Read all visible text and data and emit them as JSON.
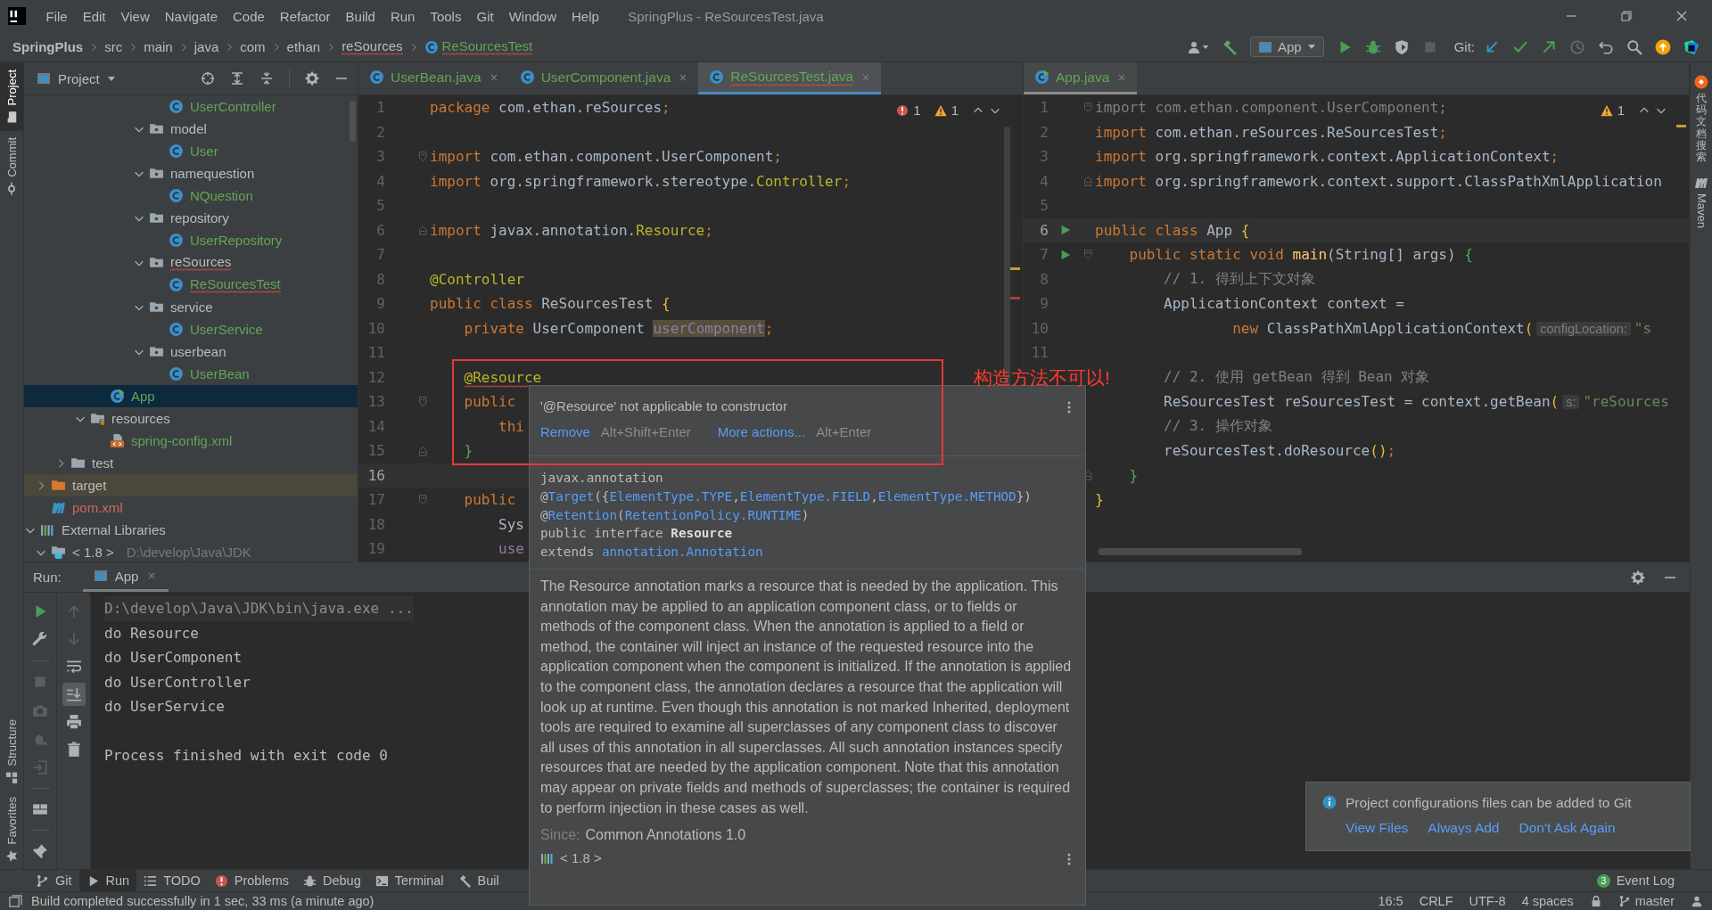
{
  "title_bar": {
    "menus": [
      "File",
      "Edit",
      "View",
      "Navigate",
      "Code",
      "Refactor",
      "Build",
      "Run",
      "Tools",
      "Git",
      "Window",
      "Help"
    ],
    "title": "SpringPlus - ReSourcesTest.java"
  },
  "nav_bar": {
    "breadcrumbs": [
      {
        "label": "SpringPlus",
        "kind": "project",
        "error": false
      },
      {
        "label": "src",
        "kind": "folder",
        "error": false
      },
      {
        "label": "main",
        "kind": "folder",
        "error": false
      },
      {
        "label": "java",
        "kind": "folder",
        "error": false
      },
      {
        "label": "com",
        "kind": "folder",
        "error": false
      },
      {
        "label": "ethan",
        "kind": "folder",
        "error": false
      },
      {
        "label": "reSources",
        "kind": "folder",
        "error": true
      },
      {
        "label": "ReSourcesTest",
        "kind": "class",
        "error": true
      }
    ],
    "run_config": "App",
    "git_label": "Git:"
  },
  "left_stripe": {
    "top": [
      {
        "label": "Project",
        "selected": true
      },
      {
        "label": "Commit",
        "selected": false
      }
    ],
    "bottom": [
      {
        "label": "Structure",
        "selected": false
      },
      {
        "label": "Favorites",
        "selected": false
      }
    ]
  },
  "right_stripe": [
    {
      "label": "代码文档搜索",
      "kind": "cjk"
    },
    {
      "label": "Maven",
      "kind": "latin"
    }
  ],
  "project_panel": {
    "title": "Project",
    "tree": [
      {
        "children": [
          {
            "children": [
              {
                "children": [
                  {
                    "children": [
                      {
                        "children": [
                          {
                            "children": [
                              {
                                "children": [
                                  {
                                    "label": "UserController",
                                    "kind": "class",
                                    "color": "#62a557",
                                    "selected": false,
                                    "error": false
                                  }
                                ]
                              },
                              {
                                "label": "model",
                                "kind": "package",
                                "expanded": true,
                                "selected": false,
                                "error": false,
                                "children": [
                                  {
                                    "label": "User",
                                    "kind": "class",
                                    "color": "#62a557",
                                    "selected": false,
                                    "error": false
                                  }
                                ]
                              },
                              {
                                "label": "namequestion",
                                "kind": "package",
                                "expanded": true,
                                "selected": false,
                                "error": false,
                                "children": [
                                  {
                                    "label": "NQuestion",
                                    "kind": "class",
                                    "color": "#62a557",
                                    "selected": false,
                                    "error": false
                                  }
                                ]
                              },
                              {
                                "label": "repository",
                                "kind": "package",
                                "expanded": true,
                                "selected": false,
                                "error": false,
                                "children": [
                                  {
                                    "label": "UserRepository",
                                    "kind": "class",
                                    "color": "#62a557",
                                    "selected": false,
                                    "error": false
                                  }
                                ]
                              },
                              {
                                "label": "reSources",
                                "kind": "package",
                                "expanded": true,
                                "selected": false,
                                "error": true,
                                "children": [
                                  {
                                    "label": "ReSourcesTest",
                                    "kind": "class",
                                    "color": "#62a557",
                                    "selected": false,
                                    "error": true
                                  }
                                ]
                              },
                              {
                                "label": "service",
                                "kind": "package",
                                "expanded": true,
                                "selected": false,
                                "error": false,
                                "children": [
                                  {
                                    "label": "UserService",
                                    "kind": "class",
                                    "color": "#62a557",
                                    "selected": false,
                                    "error": false
                                  }
                                ]
                              },
                              {
                                "label": "userbean",
                                "kind": "package",
                                "expanded": true,
                                "selected": false,
                                "error": false,
                                "children": [
                                  {
                                    "label": "UserBean",
                                    "kind": "class",
                                    "color": "#62a557",
                                    "selected": false,
                                    "error": false
                                  }
                                ]
                              }
                            ]
                          }
                        ]
                      },
                      {
                        "label": "App",
                        "kind": "main",
                        "color": "#62a557",
                        "selected": true,
                        "error": false
                      }
                    ]
                  },
                  {
                    "label": "resources",
                    "kind": "resources",
                    "expanded": true,
                    "selected": false,
                    "error": false,
                    "children": [
                      {
                        "label": "spring-config.xml",
                        "kind": "xml",
                        "color": "#62a557",
                        "selected": false,
                        "error": false
                      }
                    ]
                  }
                ]
              },
              {
                "label": "test",
                "kind": "folder",
                "expanded": false,
                "selected": false,
                "error": false
              }
            ]
          },
          {
            "label": "target",
            "kind": "excluded",
            "expanded": false,
            "selected": false,
            "error": false
          },
          {
            "label": "pom.xml",
            "kind": "maven",
            "color": "#d1675a",
            "selected": false,
            "error": false
          }
        ]
      },
      {
        "label": "External Libraries",
        "kind": "libraries",
        "expanded": true,
        "selected": false,
        "error": false,
        "children": [
          {
            "label": "< 1.8 >",
            "detail": "D:\\develop\\Java\\JDK",
            "kind": "jdk",
            "expanded": true,
            "selected": false,
            "error": false
          }
        ]
      }
    ]
  },
  "left_editor": {
    "focused": true,
    "tabs": [
      {
        "label": "UserBean.java",
        "color": "#62a557",
        "selected": false,
        "error": false
      },
      {
        "label": "UserComponent.java",
        "color": "#62a557",
        "selected": false,
        "error": false
      },
      {
        "label": "ReSourcesTest.java",
        "color": "#62a557",
        "selected": true,
        "error": true
      }
    ],
    "errors": "1",
    "warnings": "1",
    "stripe_marks": [
      {
        "kind": "warning"
      },
      {
        "kind": "error"
      }
    ],
    "lines": [
      {
        "n": "1",
        "current": false,
        "tokens": [
          {
            "kind": "kw",
            "text": "package"
          },
          {
            "kind": "p",
            "text": " com.ethan.reSources"
          },
          {
            "kind": "kw",
            "text": ";"
          }
        ]
      },
      {
        "n": "2",
        "current": false
      },
      {
        "n": "3",
        "current": false,
        "fold_start": true,
        "tokens": [
          {
            "kind": "kw",
            "text": "import"
          },
          {
            "kind": "p",
            "text": " com.ethan.component.UserComponent"
          },
          {
            "kind": "kw",
            "text": ";"
          }
        ]
      },
      {
        "n": "4",
        "current": false,
        "tokens": [
          {
            "kind": "kw",
            "text": "import"
          },
          {
            "kind": "p",
            "text": " org.springframework.stereotype."
          },
          {
            "kind": "ann",
            "text": "Controller"
          },
          {
            "kind": "kw",
            "text": ";"
          }
        ]
      },
      {
        "n": "5",
        "current": false
      },
      {
        "n": "6",
        "current": false,
        "fold_end": true,
        "tokens": [
          {
            "kind": "kw",
            "text": "import"
          },
          {
            "kind": "p",
            "text": " javax.annotation."
          },
          {
            "kind": "ann",
            "text": "Resource"
          },
          {
            "kind": "kw",
            "text": ";"
          }
        ]
      },
      {
        "n": "7",
        "current": false
      },
      {
        "n": "8",
        "current": false,
        "tokens": [
          {
            "kind": "ann",
            "text": "@Controller"
          }
        ]
      },
      {
        "n": "9",
        "current": false,
        "tokens": [
          {
            "kind": "kw",
            "text": "public class"
          },
          {
            "kind": "p",
            "text": " ReSourcesTest "
          },
          {
            "kind": "by",
            "text": "{"
          }
        ]
      },
      {
        "n": "10",
        "current": false,
        "tokens": [
          {
            "kind": "kw",
            "text": "    private"
          },
          {
            "kind": "p",
            "text": " UserComponent "
          },
          {
            "kind": "fldh",
            "text": "userComponent"
          },
          {
            "kind": "kw",
            "text": ";"
          }
        ]
      },
      {
        "n": "11",
        "current": false
      },
      {
        "n": "12",
        "current": false,
        "tokens": [
          {
            "kind": "annerr",
            "text": "    @Resource"
          }
        ]
      },
      {
        "n": "13",
        "current": false,
        "fold_start": true,
        "tokens": [
          {
            "kind": "kw",
            "text": "    public"
          }
        ]
      },
      {
        "n": "14",
        "current": false,
        "tokens": [
          {
            "kind": "kw",
            "text": "        thi"
          }
        ]
      },
      {
        "n": "15",
        "current": false,
        "fold_end": true,
        "tokens": [
          {
            "kind": "bg",
            "text": "    }"
          }
        ]
      },
      {
        "n": "16",
        "current": true
      },
      {
        "n": "17",
        "current": false,
        "fold_start": true,
        "tokens": [
          {
            "kind": "kw",
            "text": "    public"
          }
        ]
      },
      {
        "n": "18",
        "current": false,
        "tokens": [
          {
            "kind": "p",
            "text": "        Sys"
          }
        ]
      },
      {
        "n": "19",
        "current": false,
        "tokens": [
          {
            "kind": "fld",
            "text": "        use"
          }
        ]
      }
    ]
  },
  "right_editor": {
    "focused": false,
    "tabs": [
      {
        "label": "App.java",
        "color": "#62a557",
        "selected": true,
        "error": false
      }
    ],
    "warnings": "1",
    "stripe_marks": [
      {
        "kind": "warning"
      }
    ],
    "lines": [
      {
        "n": "1",
        "current": false,
        "fold_start": true,
        "tokens": [
          {
            "kind": "un",
            "text": "import com.ethan.component.UserComponent;"
          }
        ]
      },
      {
        "n": "2",
        "current": false,
        "tokens": [
          {
            "kind": "kw",
            "text": "import"
          },
          {
            "kind": "p",
            "text": " com.ethan.reSources.ReSourcesTest"
          },
          {
            "kind": "kw",
            "text": ";"
          }
        ]
      },
      {
        "n": "3",
        "current": false,
        "tokens": [
          {
            "kind": "kw",
            "text": "import"
          },
          {
            "kind": "p",
            "text": " org.springframework.context.ApplicationContext"
          },
          {
            "kind": "kw",
            "text": ";"
          }
        ]
      },
      {
        "n": "4",
        "current": false,
        "fold_end": true,
        "tokens": [
          {
            "kind": "kw",
            "text": "import"
          },
          {
            "kind": "p",
            "text": " org.springframework.context.support.ClassPathXmlApplication"
          }
        ]
      },
      {
        "n": "5",
        "current": false
      },
      {
        "n": "6",
        "current": true,
        "runnable": true,
        "tokens": [
          {
            "kind": "kw",
            "text": "public class"
          },
          {
            "kind": "p",
            "text": " App "
          },
          {
            "kind": "by",
            "text": "{"
          }
        ]
      },
      {
        "n": "7",
        "current": false,
        "runnable": true,
        "fold_start": true,
        "tokens": [
          {
            "kind": "kw",
            "text": "    public static void "
          },
          {
            "kind": "mth",
            "text": "main"
          },
          {
            "kind": "p",
            "text": "(String[] args) "
          },
          {
            "kind": "bg",
            "text": "{"
          }
        ]
      },
      {
        "n": "8",
        "current": false,
        "tokens": [
          {
            "kind": "com",
            "text": "        // 1. 得到上下文对象"
          }
        ]
      },
      {
        "n": "9",
        "current": false,
        "tokens": [
          {
            "kind": "p",
            "text": "        ApplicationContext context ="
          }
        ]
      },
      {
        "n": "10",
        "current": false,
        "tokens": [
          {
            "kind": "kw",
            "text": "                new"
          },
          {
            "kind": "p",
            "text": " ClassPathXmlApplicationContext"
          },
          {
            "kind": "by",
            "text": "("
          },
          {
            "kind": "hint",
            "text": "configLocation:"
          },
          {
            "kind": "str",
            "text": "\"s"
          }
        ]
      },
      {
        "n": "11",
        "current": false
      },
      {
        "current": false,
        "tokens": [
          {
            "kind": "com",
            "text": "        // 2. 使用 getBean 得到 Bean 对象"
          }
        ]
      },
      {
        "current": false,
        "tokens": [
          {
            "kind": "p",
            "text": "        ReSourcesTest reSourcesTest = context.getBean"
          },
          {
            "kind": "by",
            "text": "("
          },
          {
            "kind": "hint",
            "text": "s:"
          },
          {
            "kind": "str",
            "text": "\"reSources"
          }
        ]
      },
      {
        "current": false,
        "tokens": [
          {
            "kind": "com",
            "text": "        // 3. 操作对象"
          }
        ]
      },
      {
        "current": false,
        "tokens": [
          {
            "kind": "p",
            "text": "        reSourcesTest.doResource"
          },
          {
            "kind": "by",
            "text": "()"
          },
          {
            "kind": "kw",
            "text": ";"
          }
        ]
      },
      {
        "current": false,
        "fold_end": true,
        "tokens": [
          {
            "kind": "bg",
            "text": "    }"
          }
        ]
      },
      {
        "current": false,
        "tokens": [
          {
            "kind": "by",
            "text": "}"
          }
        ]
      }
    ]
  },
  "run_panel": {
    "title": "Run:",
    "tabs": [
      {
        "label": "App",
        "selected": true
      }
    ],
    "console": [
      {
        "kind": "command",
        "text": "D:\\develop\\Java\\JDK\\bin\\java.exe ..."
      },
      {
        "kind": "output",
        "text": "do Resource"
      },
      {
        "kind": "output",
        "text": "do UserComponent"
      },
      {
        "kind": "output",
        "text": "do UserController"
      },
      {
        "kind": "output",
        "text": "do UserService"
      },
      {
        "kind": "exit",
        "text": "Process finished with exit code 0"
      }
    ]
  },
  "popup": {
    "message": "'@Resource' not applicable to constructor",
    "actions": [
      {
        "label": "Remove",
        "shortcut": "Alt+Shift+Enter"
      },
      {
        "label": "More actions...",
        "shortcut": "Alt+Enter"
      }
    ],
    "declaration": [
      [
        {
          "kind": "p",
          "text": "javax.annotation"
        }
      ],
      [
        {
          "kind": "p",
          "text": "@"
        },
        {
          "kind": "link",
          "text": "Target"
        },
        {
          "kind": "p",
          "text": "({"
        },
        {
          "kind": "link",
          "text": "ElementType.TYPE"
        },
        {
          "kind": "p",
          "text": ","
        },
        {
          "kind": "link",
          "text": "ElementType.FIELD"
        },
        {
          "kind": "p",
          "text": ","
        },
        {
          "kind": "link",
          "text": "ElementType.METHOD"
        },
        {
          "kind": "p",
          "text": "})"
        }
      ],
      [
        {
          "kind": "p",
          "text": "@"
        },
        {
          "kind": "link",
          "text": "Retention"
        },
        {
          "kind": "p",
          "text": "("
        },
        {
          "kind": "link",
          "text": "RetentionPolicy.RUNTIME"
        },
        {
          "kind": "p",
          "text": ")"
        }
      ],
      [
        {
          "kind": "p",
          "text": "public interface "
        },
        {
          "kind": "b",
          "text": "Resource"
        }
      ],
      [
        {
          "kind": "p",
          "text": "extends "
        },
        {
          "kind": "link",
          "text": "annotation.Annotation"
        }
      ]
    ],
    "description": "The Resource annotation marks a resource that is needed by the application. This annotation may be applied to an application component class, or to fields or methods of the component class. When the annotation is applied to a field or method, the container will inject an instance of the requested resource into the application component when the component is initialized. If the annotation is applied to the component class, the annotation declares a resource that the application will look up at runtime. Even though this annotation is not marked Inherited, deployment tools are required to examine all superclasses of any component class to discover all uses of this annotation in all superclasses. All such annotation instances specify resources that are needed by the application component. Note that this annotation may appear on private fields and methods of superclasses; the container is required to perform injection in these cases as well.",
    "since_label": "Since:",
    "since": "Common Annotations 1.0",
    "library": "< 1.8 >"
  },
  "annotation": {
    "text": "构造方法不可以!"
  },
  "notification": {
    "message": "Project configurations files can be added to Git",
    "actions": [
      "View Files",
      "Always Add",
      "Don't Ask Again"
    ]
  },
  "tool_bar": {
    "tools": [
      {
        "label": "Git",
        "selected": false
      },
      {
        "label": "Run",
        "selected": true
      },
      {
        "label": "TODO",
        "selected": false
      },
      {
        "label": "Problems",
        "selected": false
      },
      {
        "label": "Debug",
        "selected": false
      },
      {
        "label": "Terminal",
        "selected": false
      },
      {
        "label": "Buil",
        "selected": false
      }
    ],
    "event_log": {
      "label": "Event Log",
      "count": "3"
    }
  },
  "status_bar": {
    "message": "Build completed successfully in 1 sec, 33 ms (a minute ago)",
    "items": [
      "16:5",
      "CRLF",
      "UTF-8",
      "4 spaces"
    ],
    "branch": "master"
  }
}
